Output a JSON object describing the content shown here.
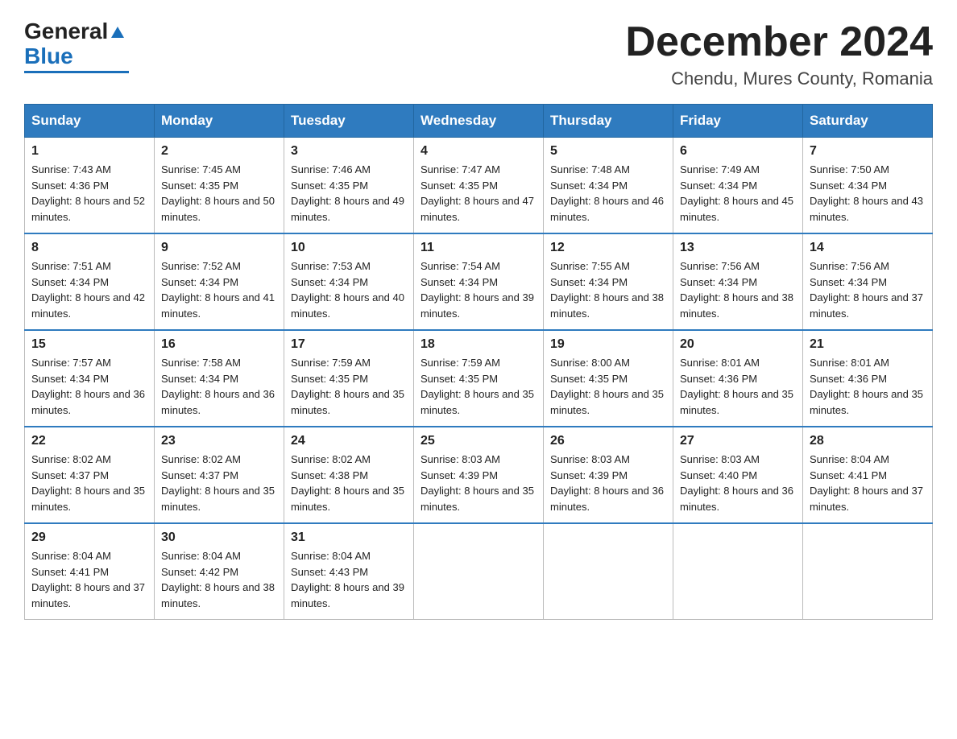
{
  "logo": {
    "general": "General",
    "blue": "Blue",
    "triangle": "▼"
  },
  "title": "December 2024",
  "subtitle": "Chendu, Mures County, Romania",
  "days_of_week": [
    "Sunday",
    "Monday",
    "Tuesday",
    "Wednesday",
    "Thursday",
    "Friday",
    "Saturday"
  ],
  "weeks": [
    [
      {
        "day": "1",
        "sunrise": "7:43 AM",
        "sunset": "4:36 PM",
        "daylight": "8 hours and 52 minutes."
      },
      {
        "day": "2",
        "sunrise": "7:45 AM",
        "sunset": "4:35 PM",
        "daylight": "8 hours and 50 minutes."
      },
      {
        "day": "3",
        "sunrise": "7:46 AM",
        "sunset": "4:35 PM",
        "daylight": "8 hours and 49 minutes."
      },
      {
        "day": "4",
        "sunrise": "7:47 AM",
        "sunset": "4:35 PM",
        "daylight": "8 hours and 47 minutes."
      },
      {
        "day": "5",
        "sunrise": "7:48 AM",
        "sunset": "4:34 PM",
        "daylight": "8 hours and 46 minutes."
      },
      {
        "day": "6",
        "sunrise": "7:49 AM",
        "sunset": "4:34 PM",
        "daylight": "8 hours and 45 minutes."
      },
      {
        "day": "7",
        "sunrise": "7:50 AM",
        "sunset": "4:34 PM",
        "daylight": "8 hours and 43 minutes."
      }
    ],
    [
      {
        "day": "8",
        "sunrise": "7:51 AM",
        "sunset": "4:34 PM",
        "daylight": "8 hours and 42 minutes."
      },
      {
        "day": "9",
        "sunrise": "7:52 AM",
        "sunset": "4:34 PM",
        "daylight": "8 hours and 41 minutes."
      },
      {
        "day": "10",
        "sunrise": "7:53 AM",
        "sunset": "4:34 PM",
        "daylight": "8 hours and 40 minutes."
      },
      {
        "day": "11",
        "sunrise": "7:54 AM",
        "sunset": "4:34 PM",
        "daylight": "8 hours and 39 minutes."
      },
      {
        "day": "12",
        "sunrise": "7:55 AM",
        "sunset": "4:34 PM",
        "daylight": "8 hours and 38 minutes."
      },
      {
        "day": "13",
        "sunrise": "7:56 AM",
        "sunset": "4:34 PM",
        "daylight": "8 hours and 38 minutes."
      },
      {
        "day": "14",
        "sunrise": "7:56 AM",
        "sunset": "4:34 PM",
        "daylight": "8 hours and 37 minutes."
      }
    ],
    [
      {
        "day": "15",
        "sunrise": "7:57 AM",
        "sunset": "4:34 PM",
        "daylight": "8 hours and 36 minutes."
      },
      {
        "day": "16",
        "sunrise": "7:58 AM",
        "sunset": "4:34 PM",
        "daylight": "8 hours and 36 minutes."
      },
      {
        "day": "17",
        "sunrise": "7:59 AM",
        "sunset": "4:35 PM",
        "daylight": "8 hours and 35 minutes."
      },
      {
        "day": "18",
        "sunrise": "7:59 AM",
        "sunset": "4:35 PM",
        "daylight": "8 hours and 35 minutes."
      },
      {
        "day": "19",
        "sunrise": "8:00 AM",
        "sunset": "4:35 PM",
        "daylight": "8 hours and 35 minutes."
      },
      {
        "day": "20",
        "sunrise": "8:01 AM",
        "sunset": "4:36 PM",
        "daylight": "8 hours and 35 minutes."
      },
      {
        "day": "21",
        "sunrise": "8:01 AM",
        "sunset": "4:36 PM",
        "daylight": "8 hours and 35 minutes."
      }
    ],
    [
      {
        "day": "22",
        "sunrise": "8:02 AM",
        "sunset": "4:37 PM",
        "daylight": "8 hours and 35 minutes."
      },
      {
        "day": "23",
        "sunrise": "8:02 AM",
        "sunset": "4:37 PM",
        "daylight": "8 hours and 35 minutes."
      },
      {
        "day": "24",
        "sunrise": "8:02 AM",
        "sunset": "4:38 PM",
        "daylight": "8 hours and 35 minutes."
      },
      {
        "day": "25",
        "sunrise": "8:03 AM",
        "sunset": "4:39 PM",
        "daylight": "8 hours and 35 minutes."
      },
      {
        "day": "26",
        "sunrise": "8:03 AM",
        "sunset": "4:39 PM",
        "daylight": "8 hours and 36 minutes."
      },
      {
        "day": "27",
        "sunrise": "8:03 AM",
        "sunset": "4:40 PM",
        "daylight": "8 hours and 36 minutes."
      },
      {
        "day": "28",
        "sunrise": "8:04 AM",
        "sunset": "4:41 PM",
        "daylight": "8 hours and 37 minutes."
      }
    ],
    [
      {
        "day": "29",
        "sunrise": "8:04 AM",
        "sunset": "4:41 PM",
        "daylight": "8 hours and 37 minutes."
      },
      {
        "day": "30",
        "sunrise": "8:04 AM",
        "sunset": "4:42 PM",
        "daylight": "8 hours and 38 minutes."
      },
      {
        "day": "31",
        "sunrise": "8:04 AM",
        "sunset": "4:43 PM",
        "daylight": "8 hours and 39 minutes."
      },
      null,
      null,
      null,
      null
    ]
  ]
}
